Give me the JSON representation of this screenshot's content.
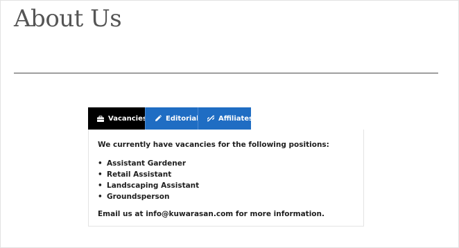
{
  "page": {
    "title": "About Us"
  },
  "tabs": [
    {
      "label": "Vacancies",
      "icon": "briefcase-icon",
      "active": true
    },
    {
      "label": "Editorial",
      "icon": "pencil-icon",
      "active": false
    },
    {
      "label": "Affiliates",
      "icon": "link-icon",
      "active": false
    }
  ],
  "panel": {
    "intro": "We currently have vacancies for the following positions:",
    "positions": [
      "Assistant Gardener",
      "Retail Assistant",
      "Landscaping Assistant",
      "Groundsperson"
    ],
    "bullet": "•",
    "contact": "Email us at info@kuwarasan.com for more information."
  },
  "colors": {
    "active_tab": "#000000",
    "inactive_tab": "#1f6dc3",
    "title_text": "#555555",
    "panel_border": "#e3e3e3"
  }
}
